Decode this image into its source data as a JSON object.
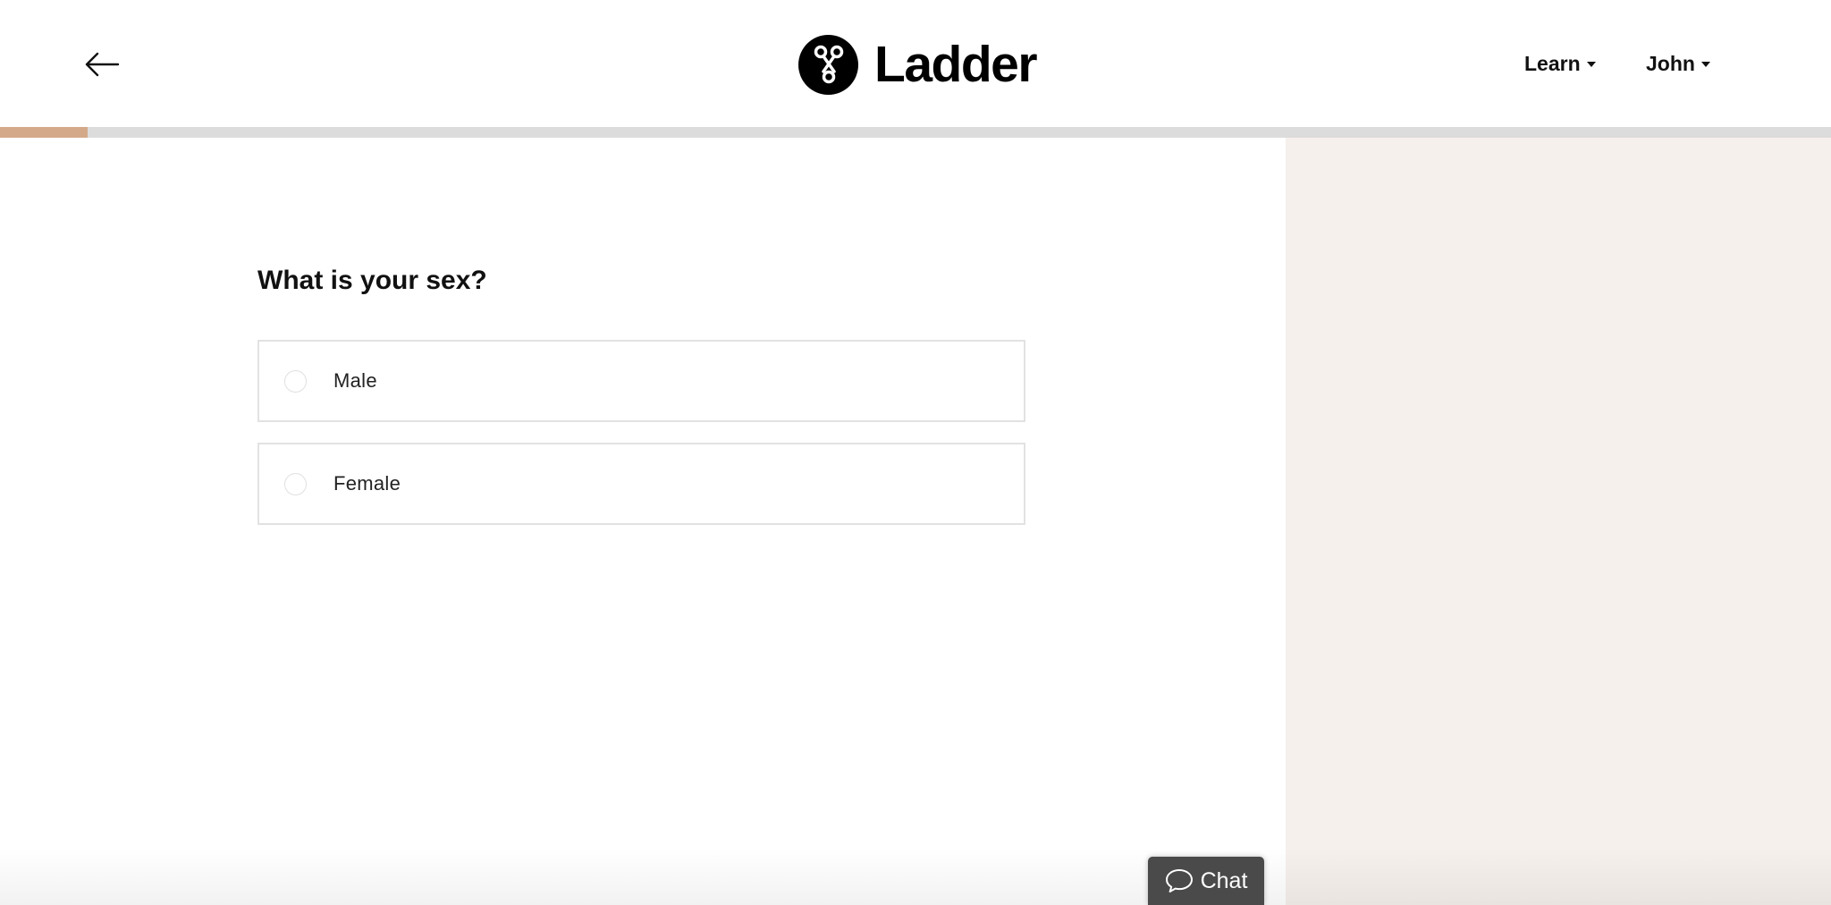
{
  "header": {
    "brand": "Ladder",
    "nav": {
      "learn_label": "Learn",
      "user_label": "John"
    }
  },
  "progress": {
    "percent": 4.8,
    "fill_color": "#d4a98a",
    "track_color": "#dcdcdc"
  },
  "question": {
    "title": "What is your sex?",
    "options": [
      {
        "label": "Male",
        "selected": false
      },
      {
        "label": "Female",
        "selected": false
      }
    ]
  },
  "chat": {
    "label": "Chat"
  },
  "colors": {
    "side_panel": "#f6f0ec",
    "chat_bg": "#4a4a4a"
  },
  "icons": {
    "back": "arrow-left-icon",
    "logo": "ladder-logo-icon",
    "dropdown": "caret-down-icon",
    "chat": "speech-bubble-icon"
  }
}
